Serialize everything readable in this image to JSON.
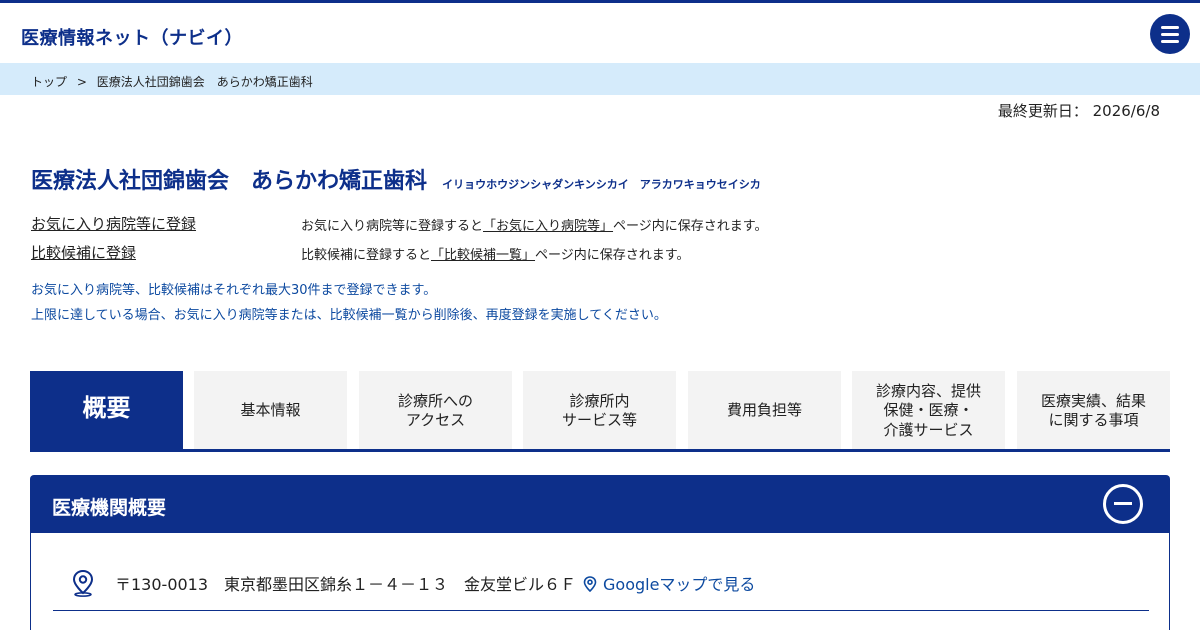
{
  "header": {
    "site_title": "医療情報ネット（ナビイ）",
    "menu_icon": "hamburger-menu-icon"
  },
  "breadcrumb": {
    "items": [
      "トップ",
      "医療法人社団錦歯会　あらかわ矯正歯科"
    ],
    "separator": ">"
  },
  "updated": "最終更新日： 2026/6/8",
  "institution": {
    "name": "医療法人社団錦歯会　あらかわ矯正歯科",
    "kana": "イリョウホウジンシャダンキンシカイ　アラカワキョウセイシカ"
  },
  "registration": {
    "favorite_link": "お気に入り病院等に登録",
    "favorite_desc_pre": "お気に入り病院等に登録すると",
    "favorite_desc_link": "「お気に入り病院等」",
    "favorite_desc_post": "ページ内に保存されます。",
    "compare_link": "比較候補に登録",
    "compare_desc_pre": "比較候補に登録すると",
    "compare_desc_link": "「比較候補一覧」",
    "compare_desc_post": "ページ内に保存されます。"
  },
  "notes": [
    "お気に入り病院等、比較候補はそれぞれ最大30件まで登録できます。",
    "上限に達している場合、お気に入り病院等または、比較候補一覧から削除後、再度登録を実施してください。"
  ],
  "tabs": [
    {
      "label": "概要",
      "active": true
    },
    {
      "label": "基本情報"
    },
    {
      "label": "診療所への\nアクセス"
    },
    {
      "label": "診療所内\nサービス等"
    },
    {
      "label": "費用負担等"
    },
    {
      "label": "診療内容、提供\n保健・医療・\n介護サービス"
    },
    {
      "label": "医療実績、結果\nに関する事項"
    }
  ],
  "panel": {
    "title": "医療機関概要",
    "collapse_icon": "minus-circle-icon",
    "address": "〒130-0013　東京都墨田区錦糸１－４－１３　金友堂ビル６Ｆ",
    "address_icon": "location-pin-icon",
    "map_link": "Googleマップで見る"
  },
  "colors": {
    "brand": "#0d2f8a",
    "breadcrumb_bg": "#d5ebfb",
    "link_blue": "#0d4aa0",
    "tab_bg": "#f3f3f3"
  }
}
